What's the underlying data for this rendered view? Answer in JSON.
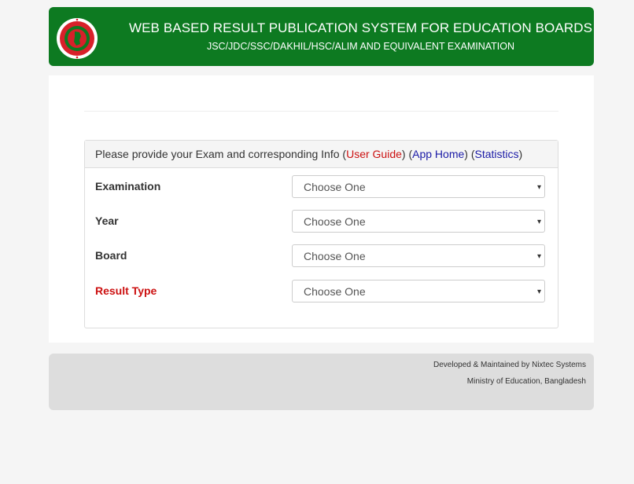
{
  "header": {
    "title": "WEB BASED RESULT PUBLICATION SYSTEM FOR EDUCATION BOARDS",
    "subtitle": "JSC/JDC/SSC/DAKHIL/HSC/ALIM AND EQUIVALENT EXAMINATION",
    "logo_icon": "government-seal-icon"
  },
  "panel": {
    "heading_text": "Please provide your Exam and corresponding Info",
    "user_guide": "User Guide",
    "app_home": "App Home",
    "statistics": "Statistics"
  },
  "form": {
    "fields": [
      {
        "label": "Examination",
        "value": "Choose One"
      },
      {
        "label": "Year",
        "value": "Choose One"
      },
      {
        "label": "Board",
        "value": "Choose One"
      },
      {
        "label": "Result Type",
        "value": "Choose One"
      }
    ],
    "caret_icon": "▾"
  },
  "footer": {
    "line1": "Developed & Maintained by Nixtec Systems",
    "line2": "Ministry of Education, Bangladesh"
  },
  "colors": {
    "header_green": "#0d7a21",
    "link_red": "#cc1111",
    "link_blue": "#1a1aa6"
  }
}
